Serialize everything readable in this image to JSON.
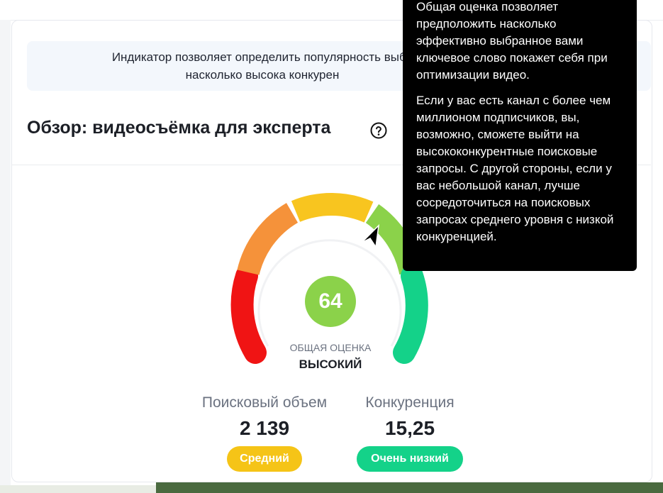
{
  "info": {
    "text": "Индикатор позволяет определить популярность выбр",
    "text_line2": "насколько высока конкурен"
  },
  "overview": {
    "title": "Обзор: видеосъёмка для эксперта"
  },
  "gauge": {
    "score": "64",
    "label": "ОБЩАЯ ОЦЕНКА",
    "value": "ВЫСОКИЙ",
    "score_fraction": 0.64,
    "colors": [
      "#f01414",
      "#f5923a",
      "#f8c51f",
      "#8bd24a",
      "#14d289"
    ]
  },
  "metrics": {
    "search_volume_label": "Поисковый объем",
    "search_volume_value": "2 139",
    "search_volume_badge": "Средний",
    "competition_label": "Конкуренция",
    "competition_value": "15,25",
    "competition_badge": "Очень низкий"
  },
  "tooltip": {
    "paragraph1": "Общая оценка позволяет предположить насколько эффективно выбранное вами ключевое слово покажет себя при оптимизации видео.",
    "paragraph2": "Если у вас есть канал с более чем миллионом подписчиков, вы, возможно, сможете выйти на высококонкурентные поисковые запросы. С другой стороны, если у вас небольшой канал, лучше сосредоточиться на поисковых запросах среднего уровня с низкой конкуренцией."
  },
  "icons": {
    "help": "question-circle-icon",
    "cursor": "mouse-pointer-icon"
  }
}
